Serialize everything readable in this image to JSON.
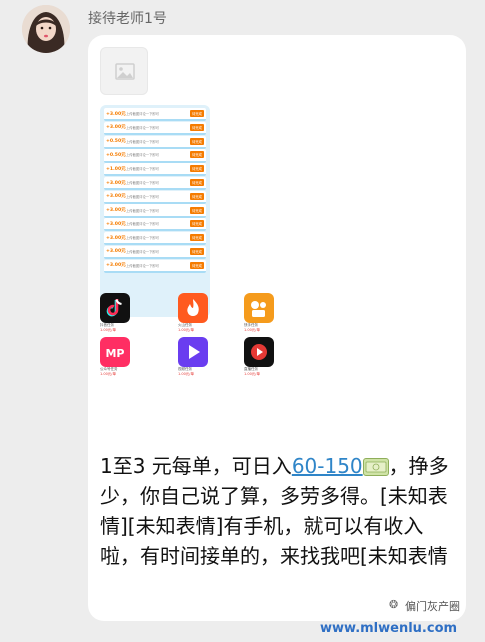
{
  "chat": {
    "sender_name": "接待老师1号",
    "message_text_1": "1至3 元每单，可日入",
    "message_link": "60-150",
    "message_text_2": "，挣多少，你自己说了算，多劳多得。[未知表情][未知表情]有手机，就可以有收入啦，有时间接单的，来找我吧[未知表情"
  },
  "screenshot": {
    "tasks": [
      {
        "amount": "+3.00元",
        "desc": "上传截图评论一下即可",
        "button": "待完成"
      },
      {
        "amount": "+3.00元",
        "desc": "上传截图评论一下即可",
        "button": "待完成"
      },
      {
        "amount": "+0.50元",
        "desc": "上传截图评论一下即可",
        "button": "待完成"
      },
      {
        "amount": "+0.50元",
        "desc": "上传截图评论一下即可",
        "button": "待完成"
      },
      {
        "amount": "+1.00元",
        "desc": "上传截图评论一下即可",
        "button": "待完成"
      },
      {
        "amount": "+3.00元",
        "desc": "上传截图评论一下即可",
        "button": "待完成"
      },
      {
        "amount": "+3.00元",
        "desc": "上传截图评论一下即可",
        "button": "待完成"
      },
      {
        "amount": "+3.00元",
        "desc": "上传截图评论一下即可",
        "button": "待完成"
      },
      {
        "amount": "+3.00元",
        "desc": "上传截图评论一下即可",
        "button": "待完成"
      },
      {
        "amount": "+3.00元",
        "desc": "上传截图评论一下即可",
        "button": "待完成"
      },
      {
        "amount": "+3.00元",
        "desc": "上传截图评论一下即可",
        "button": "待完成"
      },
      {
        "amount": "+3.00元",
        "desc": "上传截图评论一下即可",
        "button": "待完成"
      }
    ],
    "apps": [
      {
        "icon": "tiktok-app-icon",
        "name": "抖音任务",
        "price": "1.00元/单",
        "color": "#111111"
      },
      {
        "icon": "flame-app-icon",
        "name": "火山任务",
        "price": "1.00元/单",
        "color": "#ff5a1f"
      },
      {
        "icon": "camera-app-icon",
        "name": "快手任务",
        "price": "1.00元/单",
        "color": "#f59b1c"
      },
      {
        "icon": "mp-app-icon",
        "name": "公众号任务",
        "price": "1.00元/单",
        "color": "#ff2e63"
      },
      {
        "icon": "play-app-icon",
        "name": "视频任务",
        "price": "1.00元/单",
        "color": "#6a3df0"
      },
      {
        "icon": "video-app-icon",
        "name": "直播任务",
        "price": "1.00元/单",
        "color": "#111111"
      }
    ]
  },
  "watermark": {
    "brand": "偏门灰产圈",
    "site": "www.mlwenlu.com"
  },
  "colors": {
    "background": "#ededed",
    "bubble": "#ffffff",
    "link": "#2f85c8",
    "task_accent": "#f57c00"
  }
}
